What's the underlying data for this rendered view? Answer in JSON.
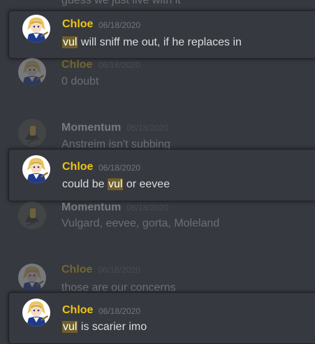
{
  "messages": {
    "top_fragment": "guess we just live with it",
    "m1": {
      "author": "Chloe",
      "date": "06/18/2020",
      "pre": "",
      "highlight": "vul",
      "post": " will sniff me out, if he replaces in"
    },
    "m2": {
      "author": "Chloe",
      "date": "06/18/2020",
      "text": "0 doubt"
    },
    "m3": {
      "author": "Momentum",
      "date": "06/18/2020",
      "text": "Anstreim isn't subbing"
    },
    "m4": {
      "author": "Chloe",
      "date": "06/18/2020",
      "pre": "could be ",
      "highlight": "vul",
      "post": " or eevee"
    },
    "m5": {
      "author": "Momentum",
      "date": "06/18/2020",
      "text": "Vulgard, eevee, gorta, Moleland"
    },
    "m6": {
      "author": "Chloe",
      "date": "06/18/2020",
      "text": "those are our concerns"
    },
    "m7": {
      "author": "Chloe",
      "date": "06/18/2020",
      "pre": "",
      "highlight": "vul",
      "post": " is scarier imo"
    }
  },
  "colors": {
    "background": "#36393f",
    "chloe_name": "#f1c40f",
    "momentum_name": "#ffffff",
    "highlight": "#705f2a",
    "timestamp": "#72767d"
  },
  "icons": {
    "chloe_avatar": "anime-character-avatar-icon",
    "momentum_avatar": "dark-avatar-icon"
  }
}
